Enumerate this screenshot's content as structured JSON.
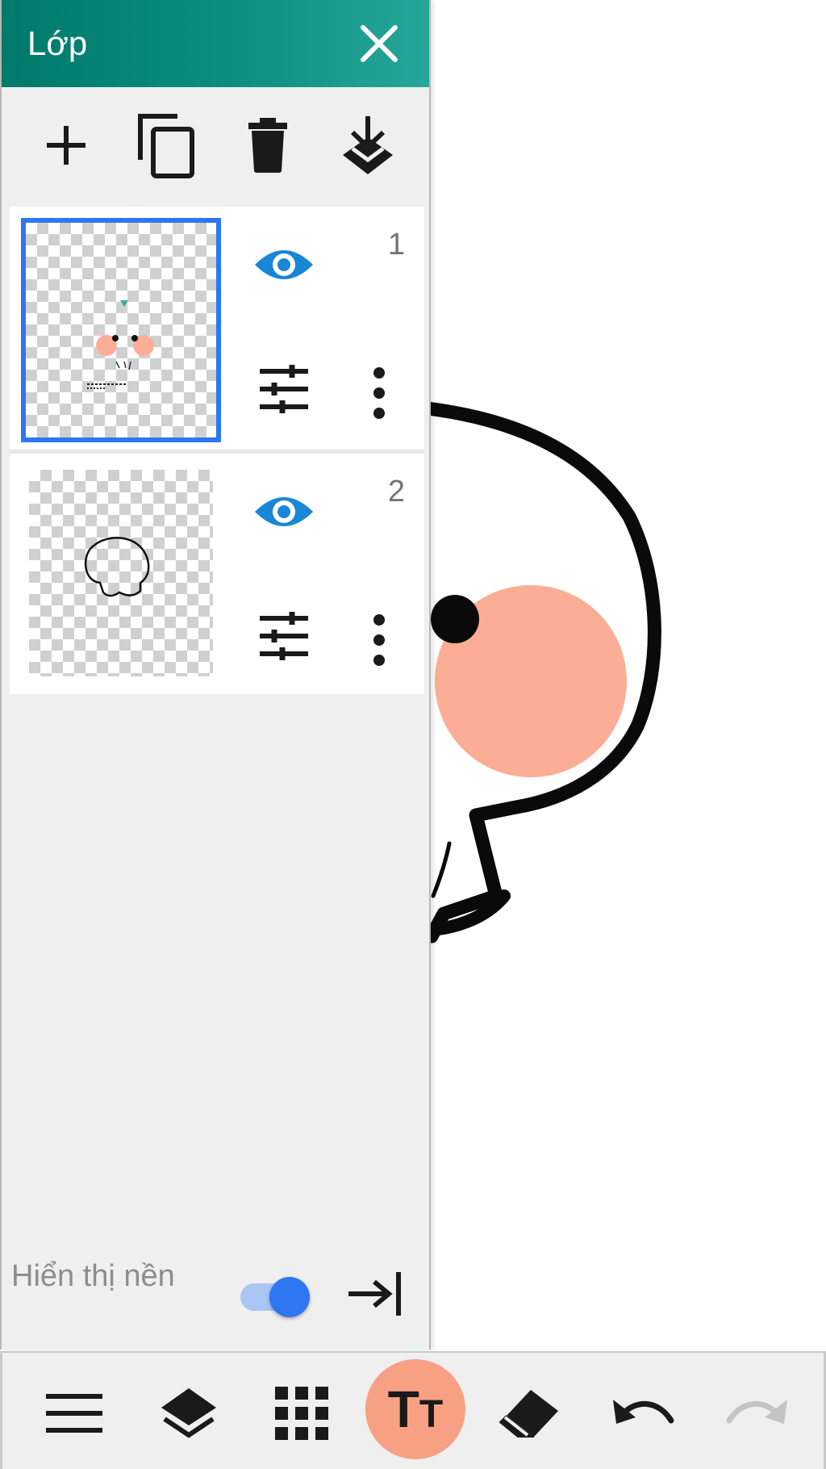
{
  "panel": {
    "title": "Lớp",
    "toolbar": [
      "add-layer",
      "duplicate-layer",
      "delete-layer",
      "merge-down"
    ]
  },
  "layers": [
    {
      "number": "1",
      "selected": true,
      "visible": true
    },
    {
      "number": "2",
      "selected": false,
      "visible": true
    }
  ],
  "background": {
    "label": "Hiển thị nền",
    "toggle_on": true
  },
  "bottom_toolbar": {
    "text_tool_big": "T",
    "text_tool_small": "T",
    "items": [
      "menu-icon",
      "layers-icon",
      "grid-icon",
      "text-tool",
      "eraser-icon",
      "undo-icon",
      "redo-icon"
    ]
  },
  "colors": {
    "accent": "#00796b",
    "selection": "#2f76f3",
    "eye": "#1a87d6",
    "active_tool": "#f7a083",
    "blush": "#fbae95"
  }
}
